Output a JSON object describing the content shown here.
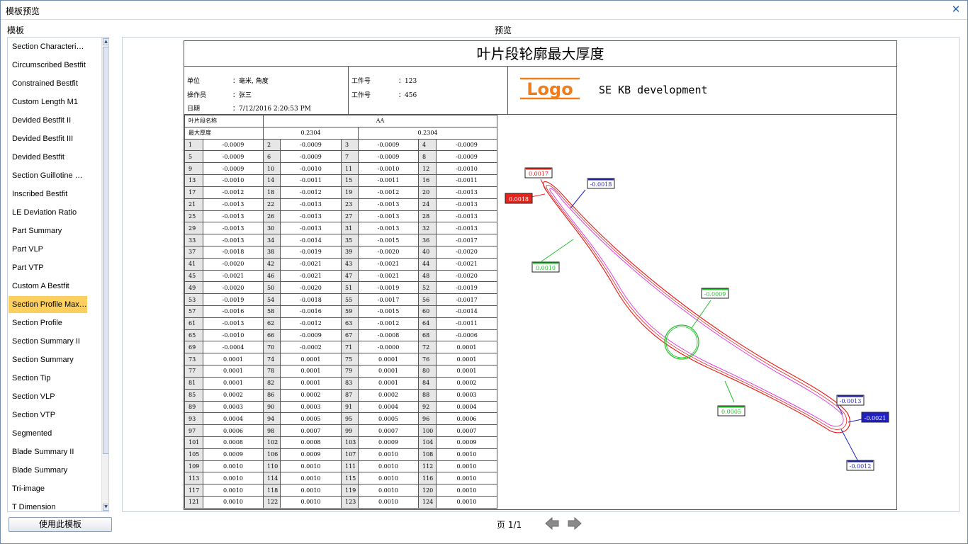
{
  "window": {
    "title": "模板预览",
    "close": "✕"
  },
  "left": {
    "label": "模板",
    "items": [
      "Section Characteristics",
      "Circumscribed Bestfit",
      "Constrained Bestfit",
      "Custom Length M1",
      "Devided Bestfit II",
      "Devided Bestfit III",
      "Devided Bestfit",
      "Section Guillotine Gauge",
      "Inscribed Bestfit",
      "LE Deviation Ratio",
      "Part Summary",
      "Part VLP",
      "Part VTP",
      "Custom A Bestfit",
      "Section Profile Maximum Thickness",
      "Section Profile",
      "Section Summary II",
      "Section Summary",
      "Section Tip",
      "Section VLP",
      "Section VTP",
      "Segmented",
      "Blade Summary II",
      "Blade Summary",
      "Tri-image",
      "T Dimension"
    ],
    "selected": 14,
    "use_button": "使用此模板"
  },
  "preview": {
    "label": "预览",
    "page": "页 1/1"
  },
  "report": {
    "title": "叶片段轮廓最大厚度",
    "header": {
      "unit_k": "单位",
      "unit_v": "：毫米, 角度",
      "operator_k": "操作员",
      "operator_v": "：张三",
      "date_k": "日期",
      "date_v": "：7/12/2016 2:20:53 PM",
      "part_k": "工件号",
      "part_v": "：123",
      "work_k": "工作号",
      "work_v": "：456",
      "logo": "Logo",
      "company": "SE KB development"
    },
    "table": {
      "name_label": "叶片段名称",
      "name_value": "AA",
      "thick_label": "最大厚度",
      "thick_v1": "0.2304",
      "thick_v2": "0.2304",
      "rows": [
        [
          "1",
          "-0.0009",
          "2",
          "-0.0009",
          "3",
          "-0.0009",
          "4",
          "-0.0009"
        ],
        [
          "5",
          "-0.0009",
          "6",
          "-0.0009",
          "7",
          "-0.0009",
          "8",
          "-0.0009"
        ],
        [
          "9",
          "-0.0009",
          "10",
          "-0.0010",
          "11",
          "-0.0010",
          "12",
          "-0.0010"
        ],
        [
          "13",
          "-0.0010",
          "14",
          "-0.0011",
          "15",
          "-0.0011",
          "16",
          "-0.0011"
        ],
        [
          "17",
          "-0.0012",
          "18",
          "-0.0012",
          "19",
          "-0.0012",
          "20",
          "-0.0013"
        ],
        [
          "21",
          "-0.0013",
          "22",
          "-0.0013",
          "23",
          "-0.0013",
          "24",
          "-0.0013"
        ],
        [
          "25",
          "-0.0013",
          "26",
          "-0.0013",
          "27",
          "-0.0013",
          "28",
          "-0.0013"
        ],
        [
          "29",
          "-0.0013",
          "30",
          "-0.0013",
          "31",
          "-0.0013",
          "32",
          "-0.0013"
        ],
        [
          "33",
          "-0.0013",
          "34",
          "-0.0014",
          "35",
          "-0.0015",
          "36",
          "-0.0017"
        ],
        [
          "37",
          "-0.0018",
          "38",
          "-0.0019",
          "39",
          "-0.0020",
          "40",
          "-0.0020"
        ],
        [
          "41",
          "-0.0020",
          "42",
          "-0.0021",
          "43",
          "-0.0021",
          "44",
          "-0.0021"
        ],
        [
          "45",
          "-0.0021",
          "46",
          "-0.0021",
          "47",
          "-0.0021",
          "48",
          "-0.0020"
        ],
        [
          "49",
          "-0.0020",
          "50",
          "-0.0020",
          "51",
          "-0.0019",
          "52",
          "-0.0019"
        ],
        [
          "53",
          "-0.0019",
          "54",
          "-0.0018",
          "55",
          "-0.0017",
          "56",
          "-0.0017"
        ],
        [
          "57",
          "-0.0016",
          "58",
          "-0.0016",
          "59",
          "-0.0015",
          "60",
          "-0.0014"
        ],
        [
          "61",
          "-0.0013",
          "62",
          "-0.0012",
          "63",
          "-0.0012",
          "64",
          "-0.0011"
        ],
        [
          "65",
          "-0.0010",
          "66",
          "-0.0009",
          "67",
          "-0.0008",
          "68",
          "-0.0006"
        ],
        [
          "69",
          "-0.0004",
          "70",
          "-0.0002",
          "71",
          "-0.0000",
          "72",
          "0.0001"
        ],
        [
          "73",
          "0.0001",
          "74",
          "0.0001",
          "75",
          "0.0001",
          "76",
          "0.0001"
        ],
        [
          "77",
          "0.0001",
          "78",
          "0.0001",
          "79",
          "0.0001",
          "80",
          "0.0001"
        ],
        [
          "81",
          "0.0001",
          "82",
          "0.0001",
          "83",
          "0.0001",
          "84",
          "0.0002"
        ],
        [
          "85",
          "0.0002",
          "86",
          "0.0002",
          "87",
          "0.0002",
          "88",
          "0.0003"
        ],
        [
          "89",
          "0.0003",
          "90",
          "0.0003",
          "91",
          "0.0004",
          "92",
          "0.0004"
        ],
        [
          "93",
          "0.0004",
          "94",
          "0.0005",
          "95",
          "0.0005",
          "96",
          "0.0006"
        ],
        [
          "97",
          "0.0006",
          "98",
          "0.0007",
          "99",
          "0.0007",
          "100",
          "0.0007"
        ],
        [
          "101",
          "0.0008",
          "102",
          "0.0008",
          "103",
          "0.0009",
          "104",
          "0.0009"
        ],
        [
          "105",
          "0.0009",
          "106",
          "0.0009",
          "107",
          "0.0010",
          "108",
          "0.0010"
        ],
        [
          "109",
          "0.0010",
          "110",
          "0.0010",
          "111",
          "0.0010",
          "112",
          "0.0010"
        ],
        [
          "113",
          "0.0010",
          "114",
          "0.0010",
          "115",
          "0.0010",
          "116",
          "0.0010"
        ],
        [
          "117",
          "0.0010",
          "118",
          "0.0010",
          "119",
          "0.0010",
          "120",
          "0.0010"
        ],
        [
          "121",
          "0.0010",
          "122",
          "0.0010",
          "123",
          "0.0010",
          "124",
          "0.0010"
        ]
      ]
    },
    "callouts": [
      {
        "text": "0.0017",
        "style": "red"
      },
      {
        "text": "0.0018",
        "style": "red-fill"
      },
      {
        "text": "-0.0018",
        "style": "blue"
      },
      {
        "text": "0.0010",
        "style": "green"
      },
      {
        "text": "-0.0009",
        "style": "green"
      },
      {
        "text": "0.0005",
        "style": "green"
      },
      {
        "text": "-0.0013",
        "style": "blue"
      },
      {
        "text": "-0.0021",
        "style": "blue-fill"
      },
      {
        "text": "-0.0012",
        "style": "blue"
      }
    ],
    "colors": {
      "red": "#e8231e",
      "blue": "#2020c8",
      "green": "#22c02a",
      "magenta": "#e040e0",
      "logo": "#f07d1a",
      "selected": "#fccf5e"
    }
  }
}
